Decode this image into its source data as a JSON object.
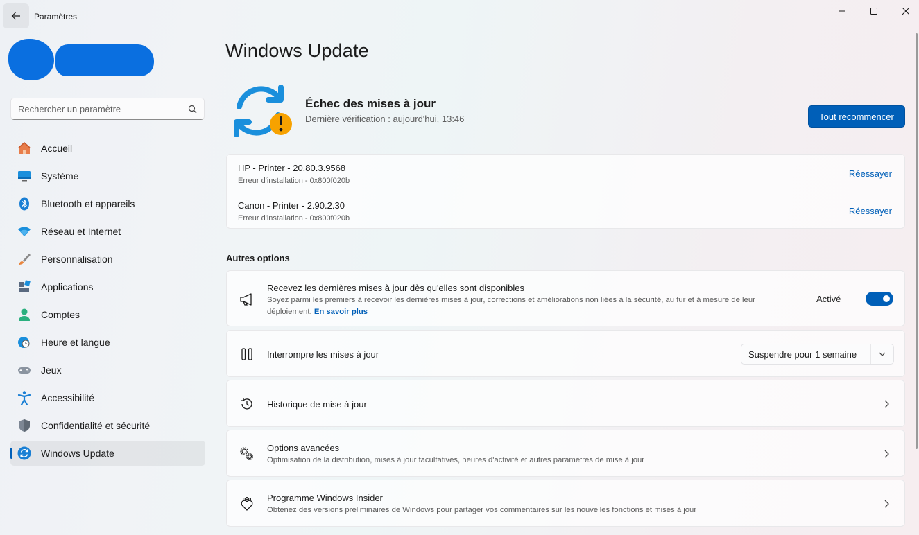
{
  "window": {
    "app_title": "Paramètres",
    "back_icon": "arrow-left-icon",
    "controls": [
      "minimize-icon",
      "maximize-icon",
      "close-icon"
    ]
  },
  "sidebar": {
    "search": {
      "placeholder": "Rechercher un paramètre",
      "value": ""
    },
    "items": [
      {
        "label": "Accueil",
        "icon": "home-icon"
      },
      {
        "label": "Système",
        "icon": "monitor-icon"
      },
      {
        "label": "Bluetooth et appareils",
        "icon": "bluetooth-icon"
      },
      {
        "label": "Réseau et Internet",
        "icon": "wifi-icon"
      },
      {
        "label": "Personnalisation",
        "icon": "brush-icon"
      },
      {
        "label": "Applications",
        "icon": "apps-icon"
      },
      {
        "label": "Comptes",
        "icon": "person-icon"
      },
      {
        "label": "Heure et langue",
        "icon": "globe-clock-icon"
      },
      {
        "label": "Jeux",
        "icon": "gamepad-icon"
      },
      {
        "label": "Accessibilité",
        "icon": "accessibility-icon"
      },
      {
        "label": "Confidentialité et sécurité",
        "icon": "shield-icon"
      },
      {
        "label": "Windows Update",
        "icon": "windows-update-icon",
        "active": true
      }
    ]
  },
  "main": {
    "title": "Windows Update",
    "status": {
      "title": "Échec des mises à jour",
      "subtitle": "Dernière vérification : aujourd'hui, 13:46",
      "icon": "sync-warning-icon",
      "action_label": "Tout recommencer"
    },
    "updates": [
      {
        "name": "HP - Printer - 20.80.3.9568",
        "error": "Erreur d'installation - 0x800f020b",
        "action": "Réessayer"
      },
      {
        "name": "Canon - Printer - 2.90.2.30",
        "error": "Erreur d'installation - 0x800f020b",
        "action": "Réessayer"
      }
    ],
    "other_options_title": "Autres options",
    "options": {
      "latest": {
        "title": "Recevez les dernières mises à jour dès qu'elles sont disponibles",
        "desc_line1": "Soyez parmi les premiers à recevoir les dernières mises à jour, corrections et améliorations non liées à la sécurité, au fur et à mesure de leur",
        "desc_line2": "déploiement.",
        "link": "En savoir plus",
        "toggle_label": "Activé",
        "toggle_on": true,
        "icon": "megaphone-icon"
      },
      "pause": {
        "title": "Interrompre les mises à jour",
        "dropdown_value": "Suspendre pour 1 semaine",
        "icon": "pause-icon"
      },
      "history": {
        "title": "Historique de mise à jour",
        "icon": "history-icon"
      },
      "advanced": {
        "title": "Options avancées",
        "desc": "Optimisation de la distribution, mises à jour facultatives, heures d'activité et autres paramètres de mise à jour",
        "icon": "gears-icon"
      },
      "insider": {
        "title": "Programme Windows Insider",
        "desc": "Obtenez des versions préliminaires de Windows pour partager vos commentaires sur les nouvelles fonctions et mises à jour",
        "icon": "insider-icon"
      }
    }
  },
  "colors": {
    "accent": "#005fb8",
    "warning": "#f7a200",
    "sync_blue": "#1a8fdc"
  }
}
